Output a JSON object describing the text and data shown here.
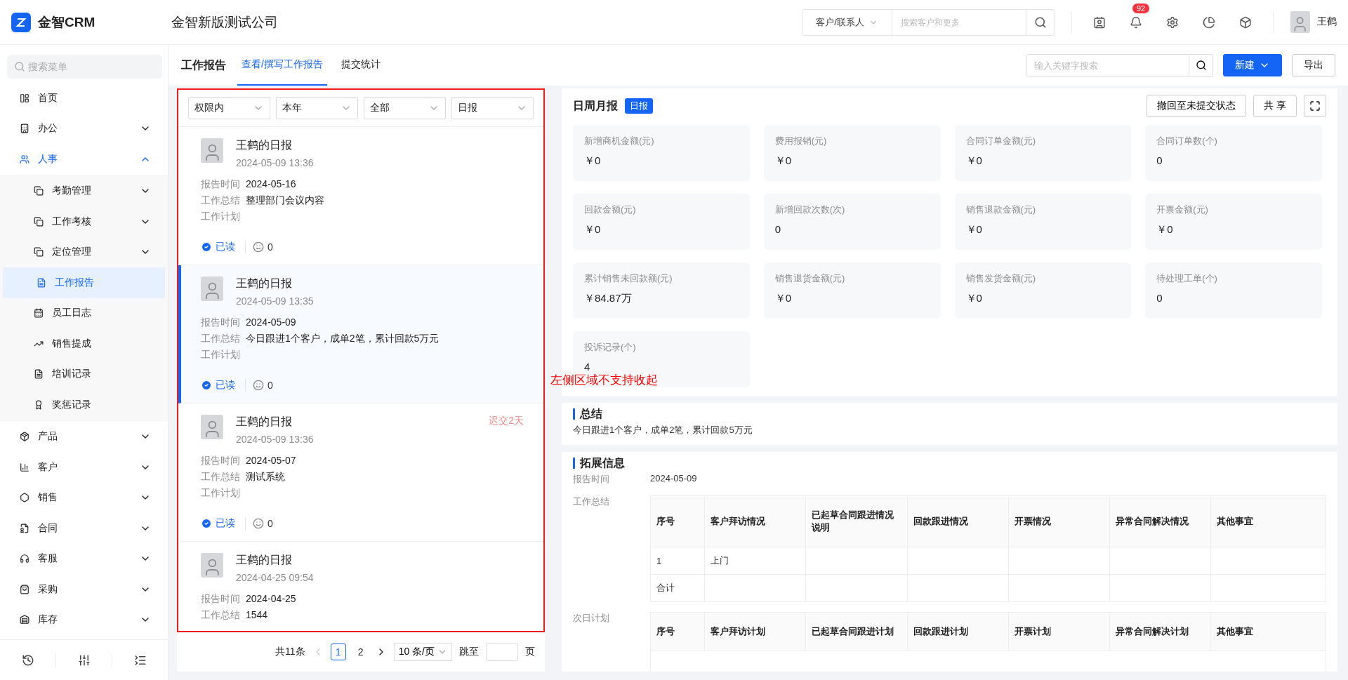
{
  "header": {
    "logo_text": "金智CRM",
    "company": "金智新版测试公司",
    "search": {
      "scope": "客户/联系人",
      "placeholder": "搜索客户和更多"
    },
    "notification_count": "92",
    "user_name": "王鹤"
  },
  "sidebar": {
    "search_placeholder": "搜索菜单",
    "items": [
      {
        "label": "首页",
        "selected": false
      },
      {
        "label": "办公",
        "selected": false,
        "expanded": false
      },
      {
        "label": "人事",
        "selected": false,
        "expanded": true,
        "children": [
          {
            "label": "考勤管理",
            "selected": false,
            "expanded": false
          },
          {
            "label": "工作考核",
            "selected": false,
            "expanded": false
          },
          {
            "label": "定位管理",
            "selected": false,
            "expanded": false
          },
          {
            "label": "工作报告",
            "selected": true
          },
          {
            "label": "员工日志",
            "selected": false
          },
          {
            "label": "销售提成",
            "selected": false
          },
          {
            "label": "培训记录",
            "selected": false
          },
          {
            "label": "奖惩记录",
            "selected": false
          }
        ]
      },
      {
        "label": "产品",
        "selected": false,
        "expanded": false
      },
      {
        "label": "客户",
        "selected": false,
        "expanded": false
      },
      {
        "label": "销售",
        "selected": false,
        "expanded": false
      },
      {
        "label": "合同",
        "selected": false,
        "expanded": false
      },
      {
        "label": "客服",
        "selected": false,
        "expanded": false
      },
      {
        "label": "采购",
        "selected": false,
        "expanded": false
      },
      {
        "label": "库存",
        "selected": false,
        "expanded": false
      }
    ]
  },
  "page": {
    "title": "工作报告",
    "tabs": [
      {
        "label": "查看/撰写工作报告",
        "selected": true
      },
      {
        "label": "提交统计",
        "selected": false
      }
    ],
    "search_placeholder": "输入关键字搜索",
    "buttons": [
      {
        "label": "新建",
        "kind": "primary"
      },
      {
        "label": "导出",
        "kind": "default"
      }
    ]
  },
  "filters": [
    "权限内",
    "本年",
    "全部",
    "日报"
  ],
  "reports": [
    {
      "title": "王鹤的日报",
      "time": "2024-05-09 13:36",
      "selected": false,
      "fields": [
        {
          "label": "报告时间",
          "value": "2024-05-16"
        },
        {
          "label": "工作总结",
          "value": "整理部门会议内容"
        },
        {
          "label": "工作计划"
        }
      ],
      "read_label": "已读",
      "comments": "0"
    },
    {
      "title": "王鹤的日报",
      "time": "2024-05-09 13:35",
      "selected": true,
      "fields": [
        {
          "label": "报告时间",
          "value": "2024-05-09"
        },
        {
          "label": "工作总结",
          "value": "今日跟进1个客户，成单2笔，累计回款5万元"
        },
        {
          "label": "工作计划"
        }
      ],
      "read_label": "已读",
      "comments": "0"
    },
    {
      "title": "王鹤的日报",
      "time": "2024-05-09 13:36",
      "selected": false,
      "late": "迟交2天",
      "fields": [
        {
          "label": "报告时间",
          "value": "2024-05-07"
        },
        {
          "label": "工作总结",
          "value": "测试系统"
        },
        {
          "label": "工作计划"
        }
      ],
      "read_label": "已读",
      "comments": "0"
    },
    {
      "title": "王鹤的日报",
      "time": "2024-04-25 09:54",
      "selected": false,
      "fields": [
        {
          "label": "报告时间",
          "value": "2024-04-25"
        },
        {
          "label": "工作总结",
          "value": "1544"
        }
      ]
    }
  ],
  "pagination": {
    "total": "共11条",
    "pages": [
      {
        "label": "1",
        "selected": true
      },
      {
        "label": "2",
        "selected": false
      }
    ],
    "page_size": "10 条/页",
    "jump_label": "跳至",
    "page_unit": "页"
  },
  "annotation": "左侧区域不支持收起",
  "detail": {
    "title": "日周月报",
    "tag": "日报",
    "buttons": [
      "撤回至未提交状态",
      "共 享"
    ],
    "stats": [
      {
        "label": "新增商机金额(元)",
        "value": "￥0"
      },
      {
        "label": "费用报销(元)",
        "value": "￥0"
      },
      {
        "label": "合同订单金额(元)",
        "value": "￥0"
      },
      {
        "label": "合同订单数(个)",
        "value": "0"
      },
      {
        "label": "回款金额(元)",
        "value": "￥0"
      },
      {
        "label": "新增回款次数(次)",
        "value": "0"
      },
      {
        "label": "销售退款金额(元)",
        "value": "￥0"
      },
      {
        "label": "开票金额(元)",
        "value": "￥0"
      },
      {
        "label": "累计销售未回款额(元)",
        "value": "￥84.87万"
      },
      {
        "label": "销售退货金额(元)",
        "value": "￥0"
      },
      {
        "label": "销售发货金额(元)",
        "value": "￥0"
      },
      {
        "label": "待处理工单(个)",
        "value": "0"
      },
      {
        "label": "投诉记录(个)",
        "value": "4"
      }
    ],
    "summary": {
      "title": "总结",
      "text": "今日跟进1个客户，成单2笔，累计回款5万元"
    },
    "extension": {
      "title": "拓展信息",
      "fields": [
        {
          "label": "报告时间",
          "value": "2024-05-09"
        }
      ],
      "tables": [
        {
          "label": "工作总结",
          "columns": [
            "序号",
            "客户拜访情况",
            "已起草合同跟进情况说明",
            "回款跟进情况",
            "开票情况",
            "异常合同解决情况",
            "其他事宜"
          ],
          "rows": [
            [
              "1",
              "上门"
            ],
            [
              "合计"
            ]
          ]
        },
        {
          "label": "次日计划",
          "columns": [
            "序号",
            "客户拜访计划",
            "已起草合同跟进计划",
            "回款跟进计划",
            "开票计划",
            "异常合同解决计划",
            "其他事宜"
          ]
        }
      ]
    }
  }
}
